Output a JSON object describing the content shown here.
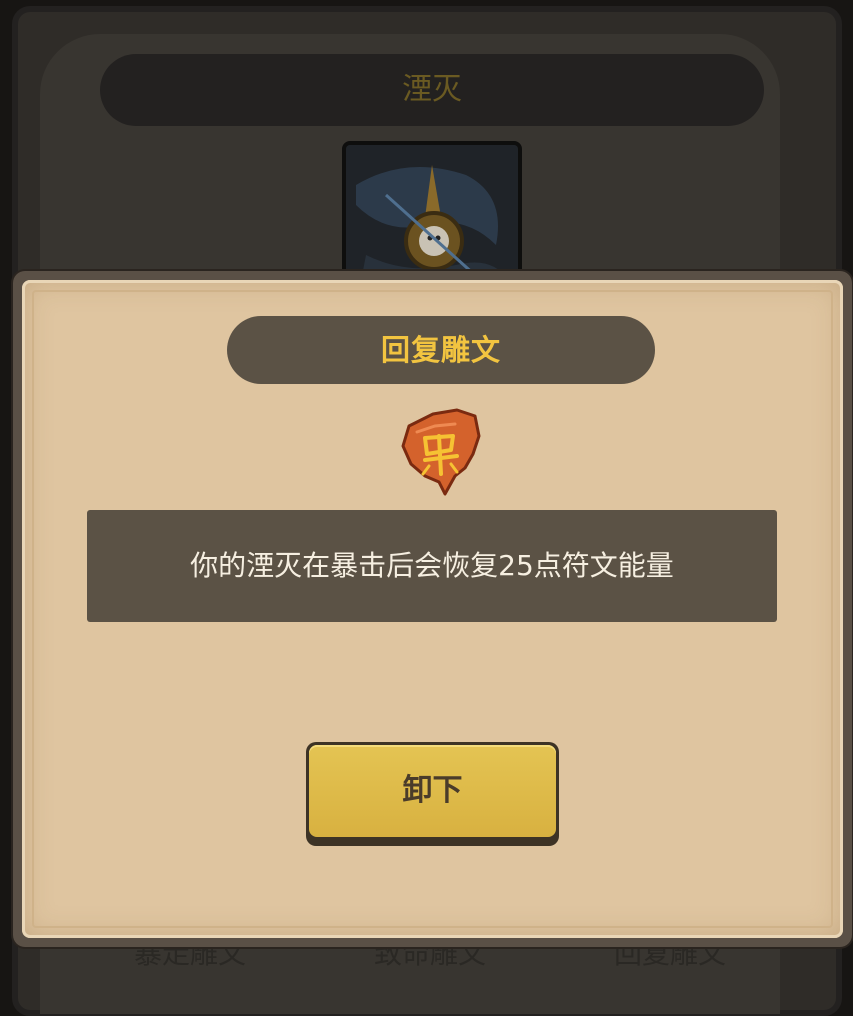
{
  "background": {
    "title": "湮灭",
    "tabs": [
      "暴走雕文",
      "致命雕文",
      "回复雕文"
    ]
  },
  "modal": {
    "title": "回复雕文",
    "rune_icon": "rune-glyph-icon",
    "description": "你的湮灭在暴击后会恢复25点符文能量",
    "unequip_label": "卸下"
  },
  "colors": {
    "title_gold": "#f2c440",
    "panel_dark": "#5b5245",
    "parchment": "#dfc5a0",
    "button_gold": "#dcb748",
    "rune_orange": "#d4622c"
  }
}
